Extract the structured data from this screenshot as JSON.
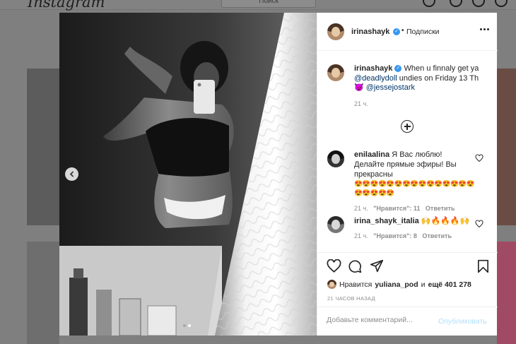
{
  "header": {
    "logo": "Instagram",
    "search_placeholder": "Поиск"
  },
  "post": {
    "username": "irinashayk",
    "follow_label": "Подписки",
    "caption_text": "When u finnaly get ya",
    "caption_mention1": "@deadlydoll",
    "caption_text2": "undies on Friday 13 Th",
    "caption_emoji": "😈",
    "caption_mention2": "@jessejostark",
    "caption_time": "21 ч.",
    "comments": [
      {
        "username": "enilaalina",
        "text": "Я Вас люблю! Делайте прямые эфиры! Вы прекрасны",
        "emojis": "😍😍😍😍😍😍😍😍😍😍😍😍😍😍😍😍😍😍😍😍",
        "time": "21 ч.",
        "likes": "\"Нравится\": 11",
        "reply": "Ответить"
      },
      {
        "username": "irina_shayk_italia",
        "text": "",
        "emojis": "🙌🔥🔥🔥🙌",
        "time": "21 ч.",
        "likes": "\"Нравится\": 8",
        "reply": "Ответить"
      }
    ],
    "likes_prefix": "Нравится",
    "likes_user": "yuliana_pod",
    "likes_and": "и",
    "likes_count": "ещё 401 278",
    "timestamp": "21 ЧАСОВ НАЗАД",
    "comment_placeholder": "Добавьте комментарий...",
    "publish_label": "Опубликовать"
  }
}
